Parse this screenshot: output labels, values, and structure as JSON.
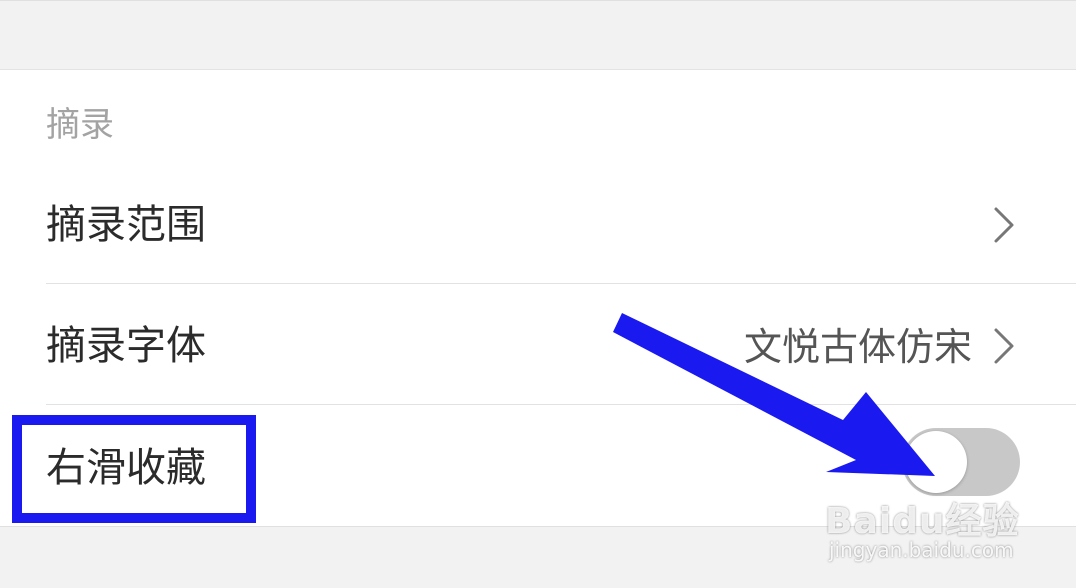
{
  "section": {
    "header": "摘录"
  },
  "rows": [
    {
      "label": "摘录范围",
      "value": "",
      "control": "chevron-right-icon"
    },
    {
      "label": "摘录字体",
      "value": "文悦古体仿宋",
      "control": "chevron-right-icon"
    },
    {
      "label": "右滑收藏",
      "value": "",
      "control": "toggle",
      "toggle_on": false
    }
  ],
  "annotation": {
    "highlight_color": "#1a1af0",
    "arrow_color": "#1a1af0"
  },
  "watermark": {
    "main": "Baidu经验",
    "url": "jingyan.baidu.com"
  }
}
